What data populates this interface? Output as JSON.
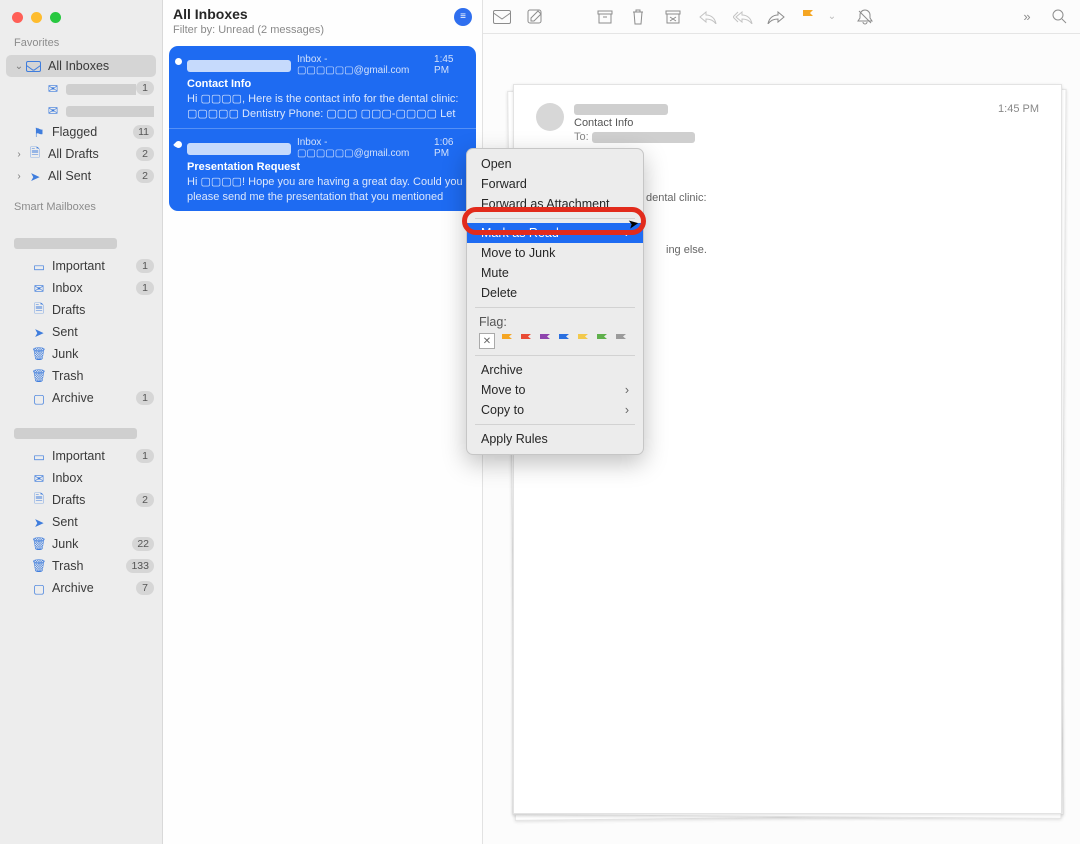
{
  "sidebar": {
    "sections": {
      "favorites": "Favorites",
      "smart": "Smart Mailboxes"
    },
    "all_inboxes": "All Inboxes",
    "sub_account_a": "▢▢▢▢▢@g…",
    "sub_account_b": "▢▢▢▢▢▢▢▢▢▢▢",
    "flagged": {
      "label": "Flagged",
      "count": "11"
    },
    "all_drafts": {
      "label": "All Drafts",
      "count": "2"
    },
    "all_sent": {
      "label": "All Sent",
      "count": "2"
    },
    "acct1_header": "▢▢▢▢▢@gmail.com",
    "acct1": {
      "important": {
        "label": "Important",
        "count": "1"
      },
      "inbox": {
        "label": "Inbox",
        "count": "1"
      },
      "drafts": {
        "label": "Drafts"
      },
      "sent": {
        "label": "Sent"
      },
      "junk": {
        "label": "Junk"
      },
      "trash": {
        "label": "Trash"
      },
      "archive": {
        "label": "Archive",
        "count": "1"
      }
    },
    "acct2_header": "▢▢▢▢▢▢▢▢▢▢▢▢▢",
    "acct2": {
      "important": {
        "label": "Important",
        "count": "1"
      },
      "inbox": {
        "label": "Inbox"
      },
      "drafts": {
        "label": "Drafts",
        "count": "2"
      },
      "sent": {
        "label": "Sent"
      },
      "junk": {
        "label": "Junk",
        "count": "22"
      },
      "trash": {
        "label": "Trash",
        "count": "133"
      },
      "archive": {
        "label": "Archive",
        "count": "7"
      }
    }
  },
  "list": {
    "title": "All Inboxes",
    "subtitle": "Filter by: Unread (2 messages)"
  },
  "messages": [
    {
      "from": "▢▢▢▢▢▢▢▢▢▢",
      "via": "Inbox - ▢▢▢▢▢▢@gmail.com",
      "time": "1:45 PM",
      "subject": "Contact Info",
      "preview": "Hi ▢▢▢▢, Here is the contact info for the dental clinic: ▢▢▢▢▢ Dentistry Phone: ▢▢▢ ▢▢▢-▢▢▢▢ Let me know if you need anyt…"
    },
    {
      "from": "▢▢▢▢▢▢▢▢▢▢",
      "via": "Inbox - ▢▢▢▢▢▢@gmail.com",
      "time": "1:06 PM",
      "subject": "Presentation Request",
      "preview": "Hi ▢▢▢▢! Hope you are having a great day. Could you please send me the presentation that you mentioned today? I would l…"
    }
  ],
  "mail": {
    "from": "▢▢▢▢▢▢▢▢▢▢",
    "subject": "Contact Info",
    "to_label": "To:",
    "to": "▢▢▢▢▢@gmail.com",
    "time": "1:45 PM",
    "body_line1": "dental clinic:",
    "body_line2": "ing else."
  },
  "context": {
    "open": "Open",
    "forward": "Forward",
    "forward_attach": "Forward as Attachment",
    "mark_read": "Mark as Read",
    "move_junk": "Move to Junk",
    "mute": "Mute",
    "delete": "Delete",
    "flag_label": "Flag:",
    "archive": "Archive",
    "move_to": "Move to",
    "copy_to": "Copy to",
    "apply_rules": "Apply Rules",
    "flag_colors": [
      "#f5a623",
      "#e94b35",
      "#8e44ad",
      "#2a6fe0",
      "#35c2e0",
      "#5fb04b",
      "#9b9b9b"
    ]
  },
  "icons": {
    "tray": "📨",
    "compose": "✎",
    "archive": "📥",
    "trash": "🗑",
    "junk": "🗑",
    "reply": "↩",
    "reply_all": "↩",
    "fwd": "↪",
    "flag": "⚑",
    "flag_dd": "⌄",
    "bell": "🔕",
    "more": "»",
    "search": "🔍"
  }
}
